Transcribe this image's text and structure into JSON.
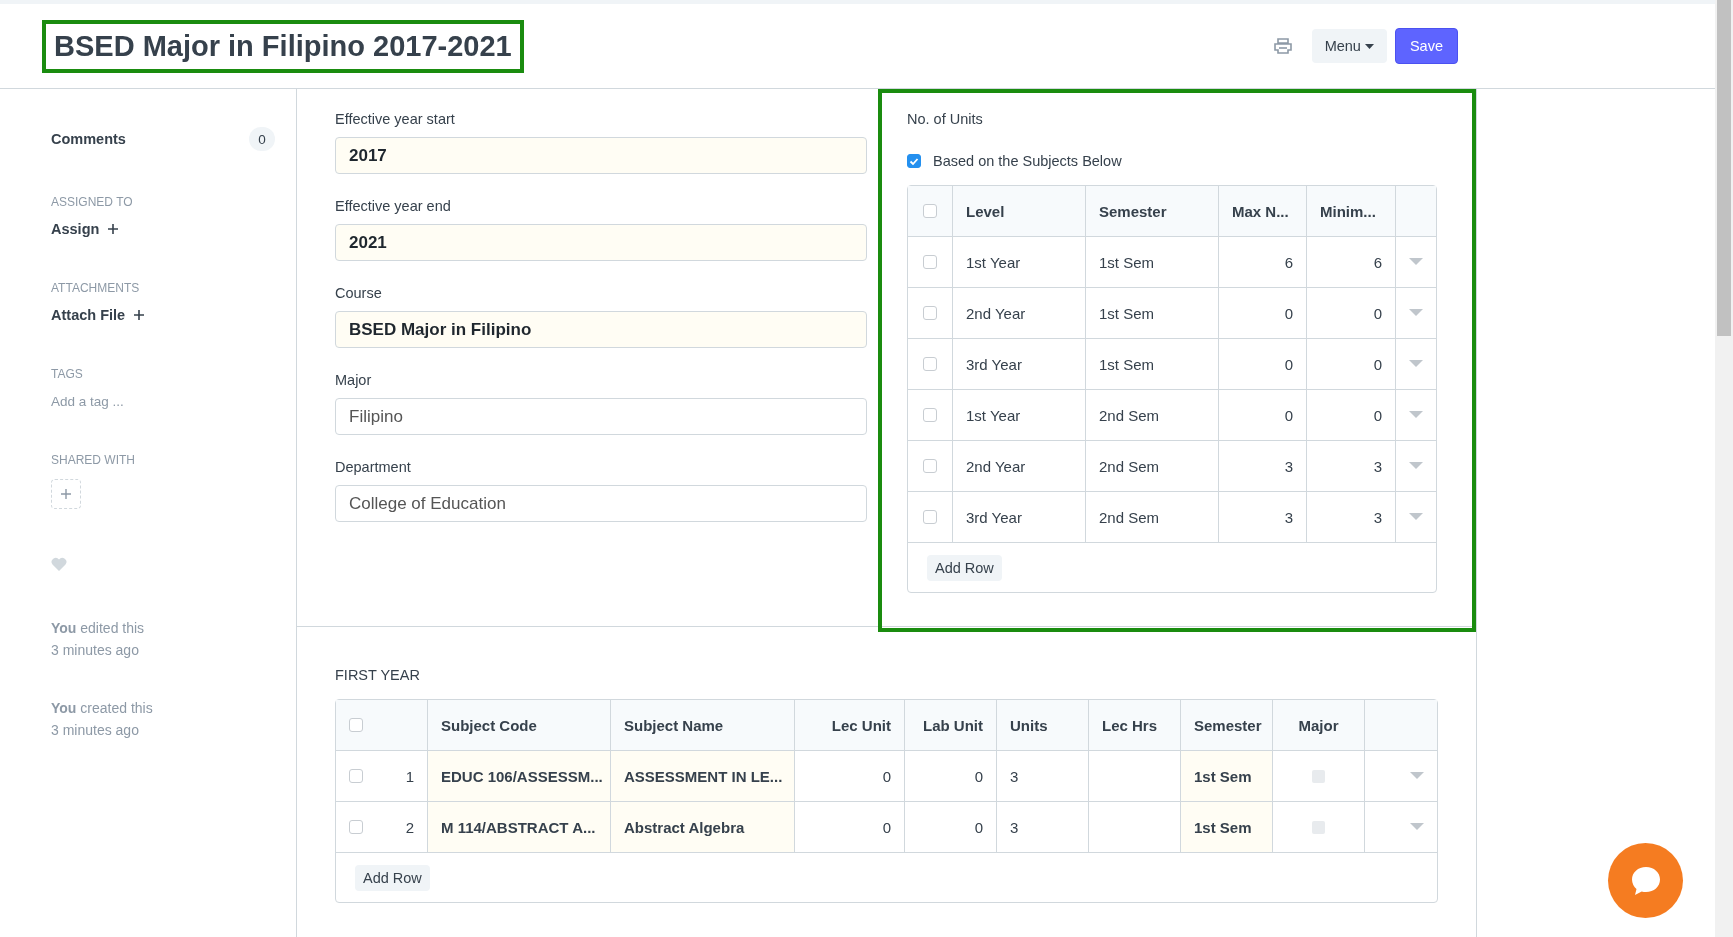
{
  "header": {
    "title": "BSED Major in Filipino 2017-2021",
    "title_highlighted": true,
    "menu_button": "Menu",
    "save_button": "Save"
  },
  "sidebar": {
    "comments": {
      "label": "Comments",
      "count": "0"
    },
    "assigned_to": {
      "heading": "ASSIGNED TO",
      "action": "Assign"
    },
    "attachments": {
      "heading": "ATTACHMENTS",
      "action": "Attach File"
    },
    "tags": {
      "heading": "TAGS",
      "placeholder": "Add a tag ..."
    },
    "shared_with": {
      "heading": "SHARED WITH"
    },
    "liked": false,
    "activity": [
      {
        "text": "**You** edited this",
        "time": "3 minutes ago"
      },
      {
        "text": "**You** created this",
        "time": "3 minutes ago"
      }
    ]
  },
  "fields": [
    {
      "label": "Effective year start",
      "value": "2017",
      "read_only": true
    },
    {
      "label": "Effective year end",
      "value": "2021",
      "read_only": true
    },
    {
      "label": "Course",
      "value": "BSED Major in Filipino",
      "read_only": true
    },
    {
      "label": "Major",
      "value": "Filipino",
      "read_only": false
    },
    {
      "label": "Department",
      "value": "College of Education",
      "read_only": false
    }
  ],
  "units_panel": {
    "highlighted": true,
    "title": "No. of Units",
    "based_on_subjects": {
      "label": "Based on the Subjects Below",
      "checked": true
    },
    "all_selected": false,
    "columns": [
      {
        "label": "Level",
        "kind": "text"
      },
      {
        "label": "Semester",
        "kind": "text"
      },
      {
        "label": "Max N...",
        "kind": "number"
      },
      {
        "label": "Minim...",
        "kind": "number"
      }
    ],
    "rows": [
      {
        "selected": false,
        "cells": [
          "1st Year",
          "1st Sem",
          "6",
          "6"
        ]
      },
      {
        "selected": false,
        "cells": [
          "2nd Year",
          "1st Sem",
          "0",
          "0"
        ]
      },
      {
        "selected": false,
        "cells": [
          "3rd Year",
          "1st Sem",
          "0",
          "0"
        ]
      },
      {
        "selected": false,
        "cells": [
          "1st Year",
          "2nd Sem",
          "0",
          "0"
        ]
      },
      {
        "selected": false,
        "cells": [
          "2nd Year",
          "2nd Sem",
          "3",
          "3"
        ]
      },
      {
        "selected": false,
        "cells": [
          "3rd Year",
          "2nd Sem",
          "3",
          "3"
        ]
      }
    ],
    "add_row": "Add Row"
  },
  "first_year": {
    "title": "FIRST YEAR",
    "all_selected": false,
    "columns": [
      {
        "label": "Subject Code",
        "kind": "readonly"
      },
      {
        "label": "Subject Name",
        "kind": "readonly"
      },
      {
        "label": "Lec Unit",
        "kind": "number"
      },
      {
        "label": "Lab Unit",
        "kind": "number"
      },
      {
        "label": "Units",
        "kind": "text"
      },
      {
        "label": "Lec Hrs",
        "kind": "text"
      },
      {
        "label": "Semester",
        "kind": "readonly"
      },
      {
        "label": "Major",
        "kind": "check"
      }
    ],
    "rows": [
      {
        "no": "1",
        "selected": false,
        "cells": [
          "EDUC 106/ASSESSM...",
          "ASSESSMENT IN LE...",
          "0",
          "0",
          "3",
          "",
          "1st Sem",
          false
        ]
      },
      {
        "no": "2",
        "selected": false,
        "cells": [
          "M 114/ABSTRACT A...",
          "Abstract Algebra",
          "0",
          "0",
          "3",
          "",
          "1st Sem",
          false
        ]
      }
    ],
    "add_row": "Add Row"
  }
}
